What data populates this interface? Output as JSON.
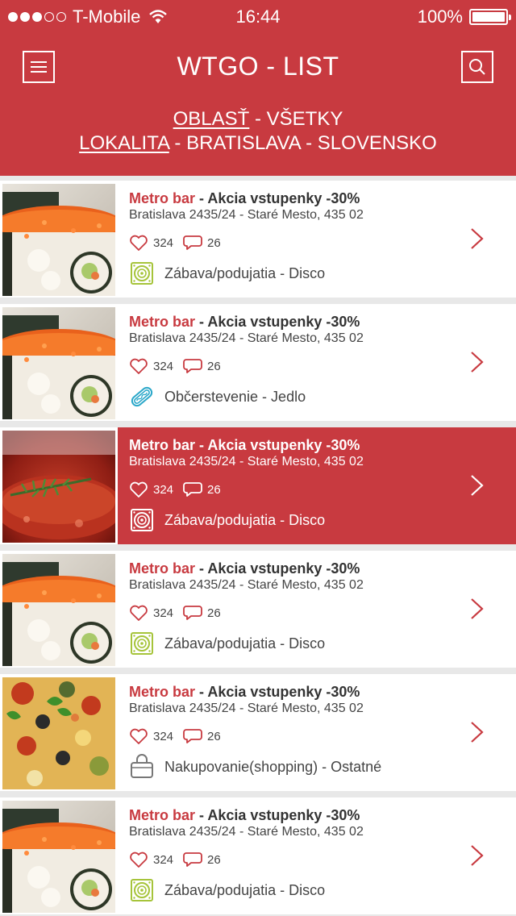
{
  "status_bar": {
    "carrier": "T-Mobile",
    "time": "16:44",
    "battery": "100%"
  },
  "header": {
    "title": "WTGO - LIST",
    "area_label": "OBLASŤ",
    "area_value": " - VŠETKY",
    "location_label": "LOKALITA",
    "location_value": " - BRATISLAVA - SLOVENSKO"
  },
  "colors": {
    "accent": "#c83a40",
    "category_green": "#a6c43a",
    "category_blue": "#2aa7c9"
  },
  "items": [
    {
      "venue": "Metro bar",
      "offer": " - Akcia vstupenky -30%",
      "address": "Bratislava 2435/24 - Staré Mesto, 435 02",
      "likes": "324",
      "comments": "26",
      "category": "Zábava/podujatia - Disco",
      "category_icon": "speaker-icon",
      "image": "sushi-image",
      "active": false
    },
    {
      "venue": "Metro bar",
      "offer": " - Akcia vstupenky -30%",
      "address": "Bratislava 2435/24 - Staré Mesto, 435 02",
      "likes": "324",
      "comments": "26",
      "category": "Občerstevenie - Jedlo",
      "category_icon": "hotdog-icon",
      "image": "sushi-image",
      "active": false
    },
    {
      "venue": "Metro bar",
      "offer": " - Akcia vstupenky -30%",
      "address": "Bratislava 2435/24 - Staré Mesto, 435 02",
      "likes": "324",
      "comments": "26",
      "category": "Zábava/podujatia - Disco",
      "category_icon": "speaker-icon",
      "image": "steak-image",
      "active": true
    },
    {
      "venue": "Metro bar",
      "offer": " - Akcia vstupenky -30%",
      "address": "Bratislava 2435/24 - Staré Mesto, 435 02",
      "likes": "324",
      "comments": "26",
      "category": "Zábava/podujatia - Disco",
      "category_icon": "speaker-icon",
      "image": "sushi-image",
      "active": false
    },
    {
      "venue": "Metro bar",
      "offer": " - Akcia vstupenky -30%",
      "address": "Bratislava 2435/24 - Staré Mesto, 435 02",
      "likes": "324",
      "comments": "26",
      "category": "Nakupovanie(shopping) - Ostatné",
      "category_icon": "shopping-bag-icon",
      "image": "pizza-image",
      "active": false
    },
    {
      "venue": "Metro bar",
      "offer": " - Akcia vstupenky -30%",
      "address": "Bratislava 2435/24 - Staré Mesto, 435 02",
      "likes": "324",
      "comments": "26",
      "category": "Zábava/podujatia - Disco",
      "category_icon": "speaker-icon",
      "image": "sushi-image",
      "active": false
    }
  ]
}
